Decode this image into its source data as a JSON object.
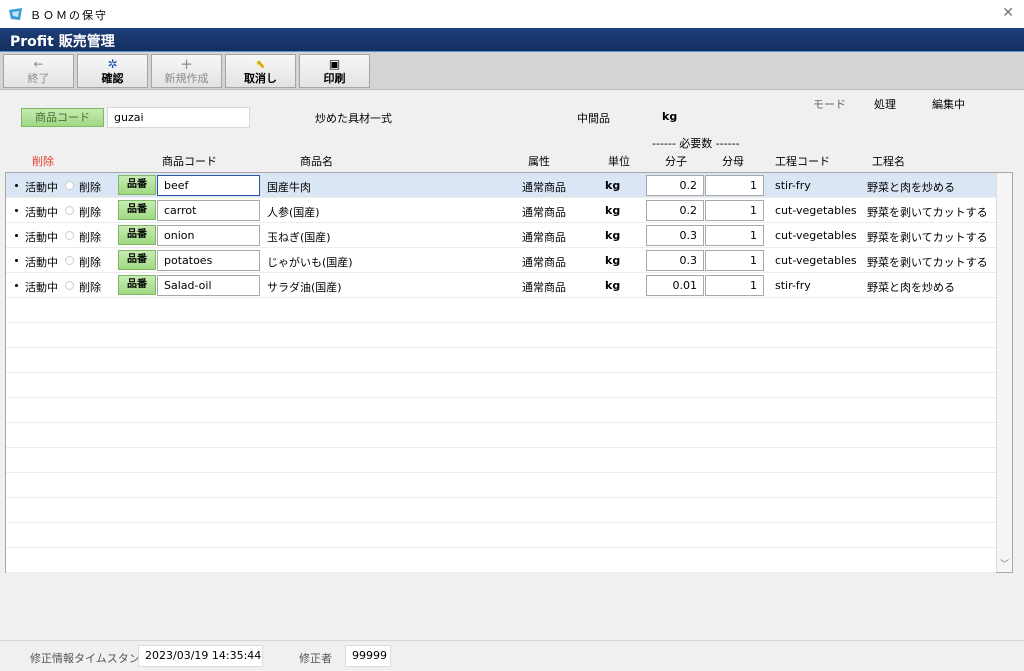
{
  "window": {
    "title": "ＢＯＭの保守",
    "close_glyph": "✕",
    "icon_color": "#3a9bd6"
  },
  "header": {
    "brand": "Profit 販売管理"
  },
  "toolbar": {
    "buttons": [
      {
        "label": "終了",
        "icon": "←",
        "icon_name": "back-arrow-icon",
        "enabled": false
      },
      {
        "label": "確認",
        "icon": "✲",
        "icon_name": "gear-icon",
        "enabled": true
      },
      {
        "label": "新規作成",
        "icon": "+",
        "icon_name": "plus-icon",
        "enabled": false
      },
      {
        "label": "取消し",
        "icon": "⬉",
        "icon_name": "undo-icon",
        "enabled": true
      },
      {
        "label": "印刷",
        "icon": "▣",
        "icon_name": "printer-icon",
        "enabled": true
      }
    ]
  },
  "form": {
    "code_button": "商品コード",
    "code_value": "guzai",
    "product_name": "炒めた具材一式",
    "category": "中間品",
    "unit": "kg",
    "mode_label": "モード",
    "mode_value": "処理",
    "status": "編集中"
  },
  "table": {
    "group_header": "------ 必要数 ------",
    "headers": {
      "delete": "削除",
      "code": "商品コード",
      "name": "商品名",
      "attribute": "属性",
      "unit": "単位",
      "numerator": "分子",
      "denominator": "分母",
      "process_code": "工程コード",
      "process_name": "工程名"
    },
    "active_label": "活動中",
    "delete_label": "削除",
    "part_button": "品番",
    "rows": [
      {
        "code": "beef",
        "name": "国産牛肉",
        "attribute": "通常商品",
        "unit": "kg",
        "numerator": "0.2",
        "denominator": "1",
        "process_code": "stir-fry",
        "process_name": "野菜と肉を炒める"
      },
      {
        "code": "carrot",
        "name": "人参(国産)",
        "attribute": "通常商品",
        "unit": "kg",
        "numerator": "0.2",
        "denominator": "1",
        "process_code": "cut-vegetables",
        "process_name": "野菜を剥いてカットする"
      },
      {
        "code": "onion",
        "name": "玉ねぎ(国産)",
        "attribute": "通常商品",
        "unit": "kg",
        "numerator": "0.3",
        "denominator": "1",
        "process_code": "cut-vegetables",
        "process_name": "野菜を剥いてカットする"
      },
      {
        "code": "potatoes",
        "name": "じゃがいも(国産)",
        "attribute": "通常商品",
        "unit": "kg",
        "numerator": "0.3",
        "denominator": "1",
        "process_code": "cut-vegetables",
        "process_name": "野菜を剥いてカットする"
      },
      {
        "code": "Salad-oil",
        "name": "サラダ油(国産)",
        "attribute": "通常商品",
        "unit": "kg",
        "numerator": "0.01",
        "denominator": "1",
        "process_code": "stir-fry",
        "process_name": "野菜と肉を炒める"
      }
    ]
  },
  "status_bar": {
    "timestamp_label": "修正情報タイムスタンプ",
    "timestamp_value": "2023/03/19 14:35:44",
    "editor_label": "修正者",
    "editor_value": "99999"
  }
}
